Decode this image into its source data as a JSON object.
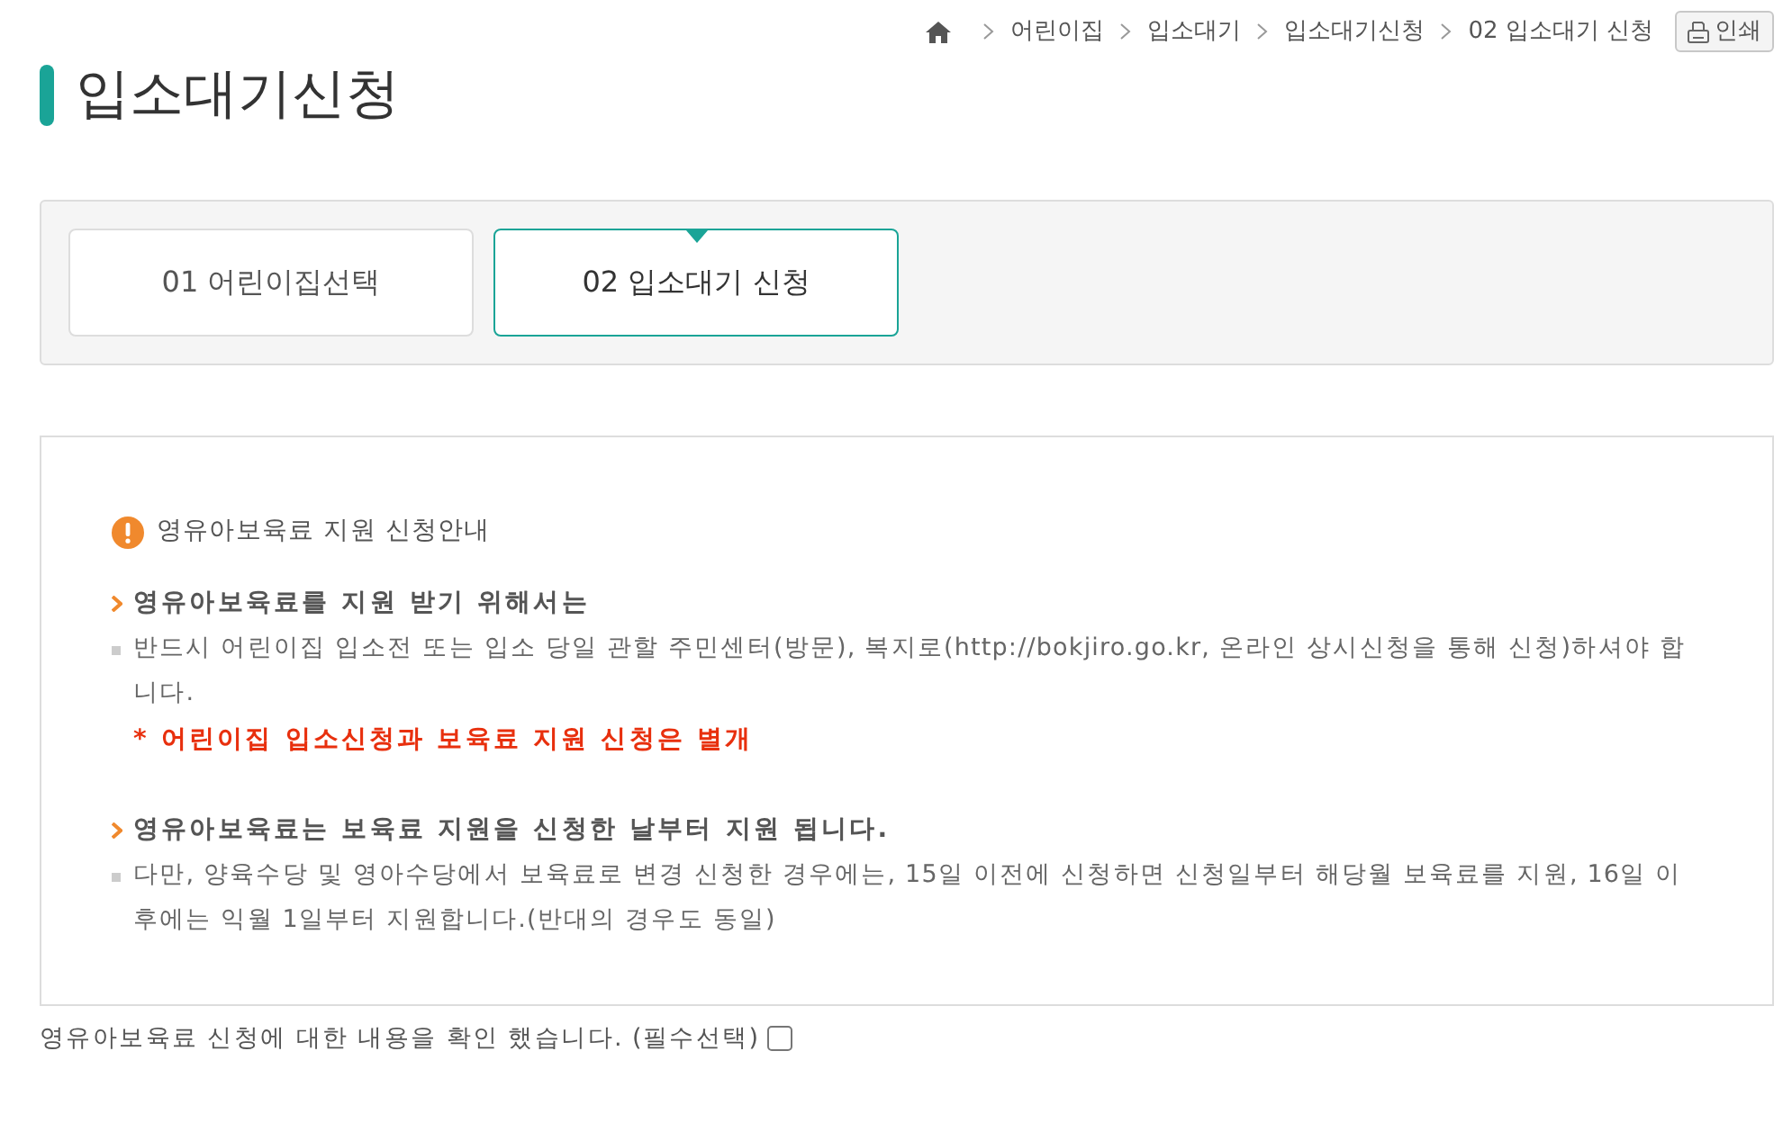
{
  "breadcrumb": {
    "items": [
      "어린이집",
      "입소대기",
      "입소대기신청",
      "02 입소대기 신청"
    ]
  },
  "print_button": {
    "label": "인쇄"
  },
  "page_title": "입소대기신청",
  "steps": [
    {
      "label": "01 어린이집선택",
      "selected": false
    },
    {
      "label": "02 입소대기 신청",
      "selected": true
    }
  ],
  "notice": {
    "title": "영유아보육료 지원 신청안내",
    "sections": [
      {
        "heading": "영유아보육료를 지원 받기 위해서는",
        "items": [
          {
            "kind": "text",
            "text": "반드시 어린이집 입소전 또는 입소 당일 관할 주민센터(방문), 복지로(http://bokjiro.go.kr, 온라인 상시신청을 통해 신청)하셔야 합니다."
          },
          {
            "kind": "warning",
            "text": "* 어린이집 입소신청과 보육료 지원 신청은 별개"
          }
        ]
      },
      {
        "heading": "영유아보육료는 보육료 지원을 신청한 날부터 지원 됩니다.",
        "items": [
          {
            "kind": "text",
            "text": "다만, 양육수당 및 영아수당에서 보육료로 변경 신청한 경우에는, 15일 이전에 신청하면 신청일부터 해당월 보육료를 지원, 16일 이후에는 익월 1일부터 지원합니다.(반대의 경우도 동일)"
          }
        ]
      }
    ]
  },
  "agreement": {
    "label": "영유아보육료 신청에 대한 내용을 확인 했습니다. (필수선택)",
    "checked": false
  }
}
